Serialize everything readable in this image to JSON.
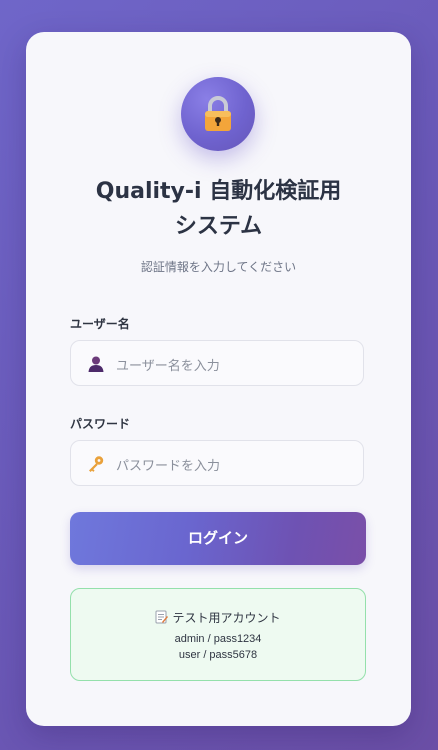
{
  "header": {
    "title_line1": "Quality-i 自動化検証用",
    "title_line2": "システム",
    "subtitle": "認証情報を入力してください"
  },
  "form": {
    "username": {
      "label": "ユーザー名",
      "placeholder": "ユーザー名を入力",
      "value": "",
      "icon": "user-icon"
    },
    "password": {
      "label": "パスワード",
      "placeholder": "パスワードを入力",
      "value": "",
      "icon": "key-icon"
    },
    "login_label": "ログイン"
  },
  "test_accounts": {
    "title": "テスト用アカウント",
    "icon": "memo-icon",
    "accounts": [
      "admin / pass1234",
      "user / pass5678"
    ]
  },
  "colors": {
    "background": "#6a59b8",
    "accent": "#6f63cf",
    "test_box_border": "#94e0ab",
    "test_box_bg": "#eefaf1"
  }
}
